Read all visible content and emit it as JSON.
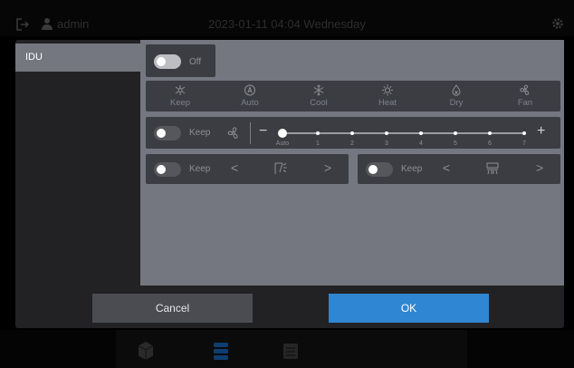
{
  "status_bar": {
    "username": "admin",
    "datetime": "2023-01-11  04:04  Wednesday",
    "icons": [
      "logout-icon",
      "user-icon",
      "settings-gear-icon"
    ]
  },
  "sidebar": {
    "items": [
      {
        "label": "IDU",
        "selected": true
      }
    ]
  },
  "power": {
    "state_label": "Off",
    "on": false
  },
  "modes": [
    {
      "label": "Keep",
      "icon": "keep-mode-icon"
    },
    {
      "label": "Auto",
      "icon": "auto-mode-icon"
    },
    {
      "label": "Cool",
      "icon": "snowflake-icon"
    },
    {
      "label": "Heat",
      "icon": "sun-icon"
    },
    {
      "label": "Dry",
      "icon": "water-drop-icon"
    },
    {
      "label": "Fan",
      "icon": "fan-icon"
    }
  ],
  "fan_speed": {
    "toggle_label": "Keep",
    "minus": "−",
    "plus": "+",
    "ticks": [
      "Auto",
      "1",
      "2",
      "3",
      "4",
      "5",
      "6",
      "7"
    ],
    "selected": "Auto"
  },
  "swing_vertical": {
    "toggle_label": "Keep",
    "prev": "<",
    "next": ">",
    "icon": "vertical-swing-icon"
  },
  "swing_horizontal": {
    "toggle_label": "Keep",
    "prev": "<",
    "next": ">",
    "icon": "horizontal-swing-icon"
  },
  "dialog_buttons": {
    "cancel": "Cancel",
    "ok": "OK"
  },
  "bottom_nav": {
    "icons": [
      "cube-icon",
      "stack-icon",
      "list-icon"
    ]
  },
  "colors": {
    "accent": "#2f86d2",
    "panel": "#3b3d43",
    "content_bg": "#74777f"
  }
}
